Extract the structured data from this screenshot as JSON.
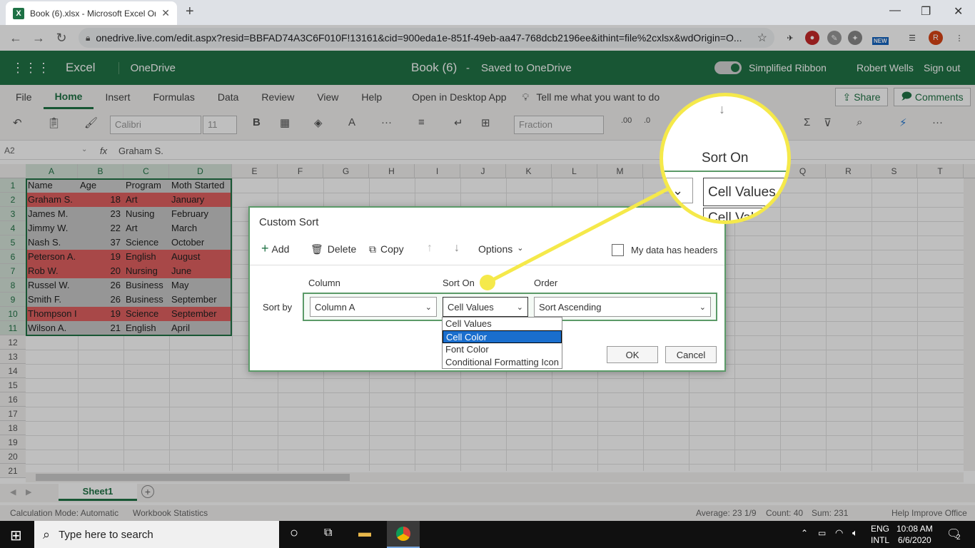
{
  "browser": {
    "tab_title": "Book (6).xlsx - Microsoft Excel Or",
    "url": "onedrive.live.com/edit.aspx?resid=BBFAD74A3C6F010F!13161&cid=900eda1e-851f-49eb-aa47-768dcb2196ee&ithint=file%2cxlsx&wdOrigin=O...",
    "new_badge": "NEW",
    "profile": "R"
  },
  "excel": {
    "app": "Excel",
    "service": "OneDrive",
    "doc": "Book (6)",
    "sep": "-",
    "saved": "Saved to OneDrive",
    "simplified": "Simplified Ribbon",
    "user": "Robert Wells",
    "signout": "Sign out"
  },
  "ribbon": {
    "tabs": [
      "File",
      "Home",
      "Insert",
      "Formulas",
      "Data",
      "Review",
      "View",
      "Help",
      "Open in Desktop App"
    ],
    "tell": "Tell me what you want to do",
    "share": "Share",
    "comments": "Comments",
    "font": "Calibri",
    "size": "11",
    "format": "Fraction",
    "more": "···"
  },
  "formula": {
    "cellref": "A2",
    "fx": "fx",
    "value": "Graham S."
  },
  "grid": {
    "cols": [
      "A",
      "B",
      "C",
      "D",
      "E",
      "F",
      "G",
      "H",
      "I",
      "J",
      "K",
      "L",
      "M",
      "N",
      "O",
      "P",
      "Q",
      "R",
      "S",
      "T"
    ],
    "rownums": [
      "1",
      "2",
      "3",
      "4",
      "5",
      "6",
      "7",
      "8",
      "9",
      "10",
      "11",
      "12",
      "13",
      "14",
      "15",
      "16",
      "17",
      "18",
      "19",
      "20",
      "21"
    ],
    "rows": [
      {
        "a": "Name",
        "b": "Age",
        "c": "Program",
        "d": "Moth Started"
      },
      {
        "a": "Graham S.",
        "b": "18",
        "c": "Art",
        "d": "January"
      },
      {
        "a": "James M.",
        "b": "23",
        "c": "Nusing",
        "d": "February"
      },
      {
        "a": "Jimmy W.",
        "b": "22",
        "c": "Art",
        "d": "March"
      },
      {
        "a": "Nash S.",
        "b": "37",
        "c": "Science",
        "d": "October"
      },
      {
        "a": "Peterson A.",
        "b": "19",
        "c": "English",
        "d": "August"
      },
      {
        "a": "Rob W.",
        "b": "20",
        "c": "Nursing",
        "d": "June"
      },
      {
        "a": "Russel W.",
        "b": "26",
        "c": "Business",
        "d": "May"
      },
      {
        "a": "Smith F.",
        "b": "26",
        "c": "Business",
        "d": "September"
      },
      {
        "a": "Thompson I",
        "b": "19",
        "c": "Science",
        "d": "September"
      },
      {
        "a": "Wilson A.",
        "b": "21",
        "c": "English",
        "d": "April"
      }
    ]
  },
  "sheet": {
    "tab": "Sheet1",
    "add": "+"
  },
  "status": {
    "mode": "Calculation Mode: Automatic",
    "stats": "Workbook Statistics",
    "average": "Average: 23 1/9",
    "count": "Count: 40",
    "sum": "Sum: 231",
    "help": "Help Improve Office"
  },
  "dialog": {
    "title": "Custom Sort",
    "add": "Add",
    "delete": "Delete",
    "copy": "Copy",
    "options": "Options",
    "headers": "My data has headers",
    "col_label": "Column",
    "sorton_label": "Sort On",
    "order_label": "Order",
    "sortby": "Sort by",
    "column_value": "Column A",
    "sorton_value": "Cell Values",
    "order_value": "Sort Ascending",
    "ok": "OK",
    "cancel": "Cancel",
    "options_list": [
      "Cell Values",
      "Cell Color",
      "Font Color",
      "Conditional Formatting Icon"
    ]
  },
  "magnifier": {
    "title": "Sort On",
    "value": "Cell Values",
    "value2": "Cell Valu"
  },
  "taskbar": {
    "search": "Type here to search",
    "lang1": "ENG",
    "lang2": "INTL",
    "time": "10:08 AM",
    "date": "6/6/2020",
    "notif": "2"
  },
  "colors": {
    "excel_green": "#217346",
    "highlight": "#e06060",
    "callout": "#f5e94a",
    "selected": "#1a6ecd"
  }
}
